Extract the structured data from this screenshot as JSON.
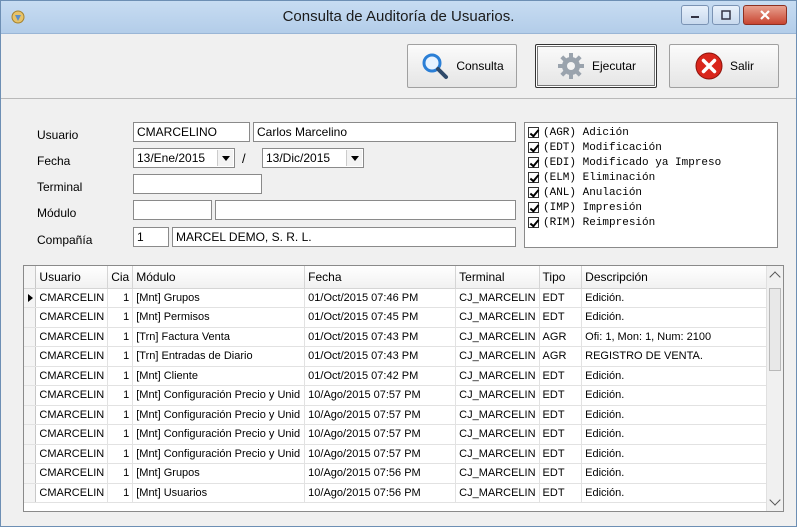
{
  "window": {
    "title": "Consulta de Auditoría de Usuarios."
  },
  "toolbar": {
    "consulta_label": "Consulta",
    "ejecutar_label": "Ejecutar",
    "salir_label": "Salir"
  },
  "filters": {
    "usuario_label": "Usuario",
    "usuario_code": "CMARCELINO",
    "usuario_name": "Carlos Marcelino",
    "fecha_label": "Fecha",
    "fecha_desde": "13/Ene/2015",
    "fecha_sep": "/",
    "fecha_hasta": "13/Dic/2015",
    "terminal_label": "Terminal",
    "terminal_value": "",
    "modulo_label": "Módulo",
    "modulo_code": "",
    "modulo_name": "",
    "compania_label": "Compañía",
    "compania_code": "1",
    "compania_name": "MARCEL DEMO, S. R. L."
  },
  "types": [
    {
      "label": "(AGR) Adición",
      "checked": true
    },
    {
      "label": "(EDT) Modificación",
      "checked": true
    },
    {
      "label": "(EDI) Modificado ya Impreso",
      "checked": true
    },
    {
      "label": "(ELM) Eliminación",
      "checked": true
    },
    {
      "label": "(ANL) Anulación",
      "checked": true
    },
    {
      "label": "(IMP) Impresión",
      "checked": true
    },
    {
      "label": "(RIM) Reimpresión",
      "checked": true
    }
  ],
  "grid": {
    "columns": [
      "Usuario",
      "Cia",
      "Módulo",
      "Fecha",
      "Terminal",
      "Tipo",
      "Descripción"
    ],
    "rows": [
      [
        "CMARCELIN",
        "1",
        "[Mnt] Grupos",
        "01/Oct/2015 07:46 PM",
        "CJ_MARCELIN",
        "EDT",
        "Edición."
      ],
      [
        "CMARCELIN",
        "1",
        "[Mnt] Permisos",
        "01/Oct/2015 07:45 PM",
        "CJ_MARCELIN",
        "EDT",
        "Edición."
      ],
      [
        "CMARCELIN",
        "1",
        "[Trn] Factura Venta",
        "01/Oct/2015 07:43 PM",
        "CJ_MARCELIN",
        "AGR",
        "Ofi: 1, Mon: 1, Num: 2100"
      ],
      [
        "CMARCELIN",
        "1",
        "[Trn] Entradas de Diario",
        "01/Oct/2015 07:43 PM",
        "CJ_MARCELIN",
        "AGR",
        "REGISTRO DE VENTA."
      ],
      [
        "CMARCELIN",
        "1",
        "[Mnt] Cliente",
        "01/Oct/2015 07:42 PM",
        "CJ_MARCELIN",
        "EDT",
        "Edición."
      ],
      [
        "CMARCELIN",
        "1",
        "[Mnt] Configuración Precio y Unid",
        "10/Ago/2015 07:57 PM",
        "CJ_MARCELIN",
        "EDT",
        "Edición."
      ],
      [
        "CMARCELIN",
        "1",
        "[Mnt] Configuración Precio y Unid",
        "10/Ago/2015 07:57 PM",
        "CJ_MARCELIN",
        "EDT",
        "Edición."
      ],
      [
        "CMARCELIN",
        "1",
        "[Mnt] Configuración Precio y Unid",
        "10/Ago/2015 07:57 PM",
        "CJ_MARCELIN",
        "EDT",
        "Edición."
      ],
      [
        "CMARCELIN",
        "1",
        "[Mnt] Configuración Precio y Unid",
        "10/Ago/2015 07:57 PM",
        "CJ_MARCELIN",
        "EDT",
        "Edición."
      ],
      [
        "CMARCELIN",
        "1",
        "[Mnt] Grupos",
        "10/Ago/2015 07:56 PM",
        "CJ_MARCELIN",
        "EDT",
        "Edición."
      ],
      [
        "CMARCELIN",
        "1",
        "[Mnt] Usuarios",
        "10/Ago/2015 07:56 PM",
        "CJ_MARCELIN",
        "EDT",
        "Edición."
      ]
    ],
    "selected_row": 0
  },
  "colors": {
    "titlebar": "#c7dcf2",
    "close_button": "#c84531",
    "exit_icon": "#d9261c",
    "search_icon": "#2b7fd6"
  }
}
